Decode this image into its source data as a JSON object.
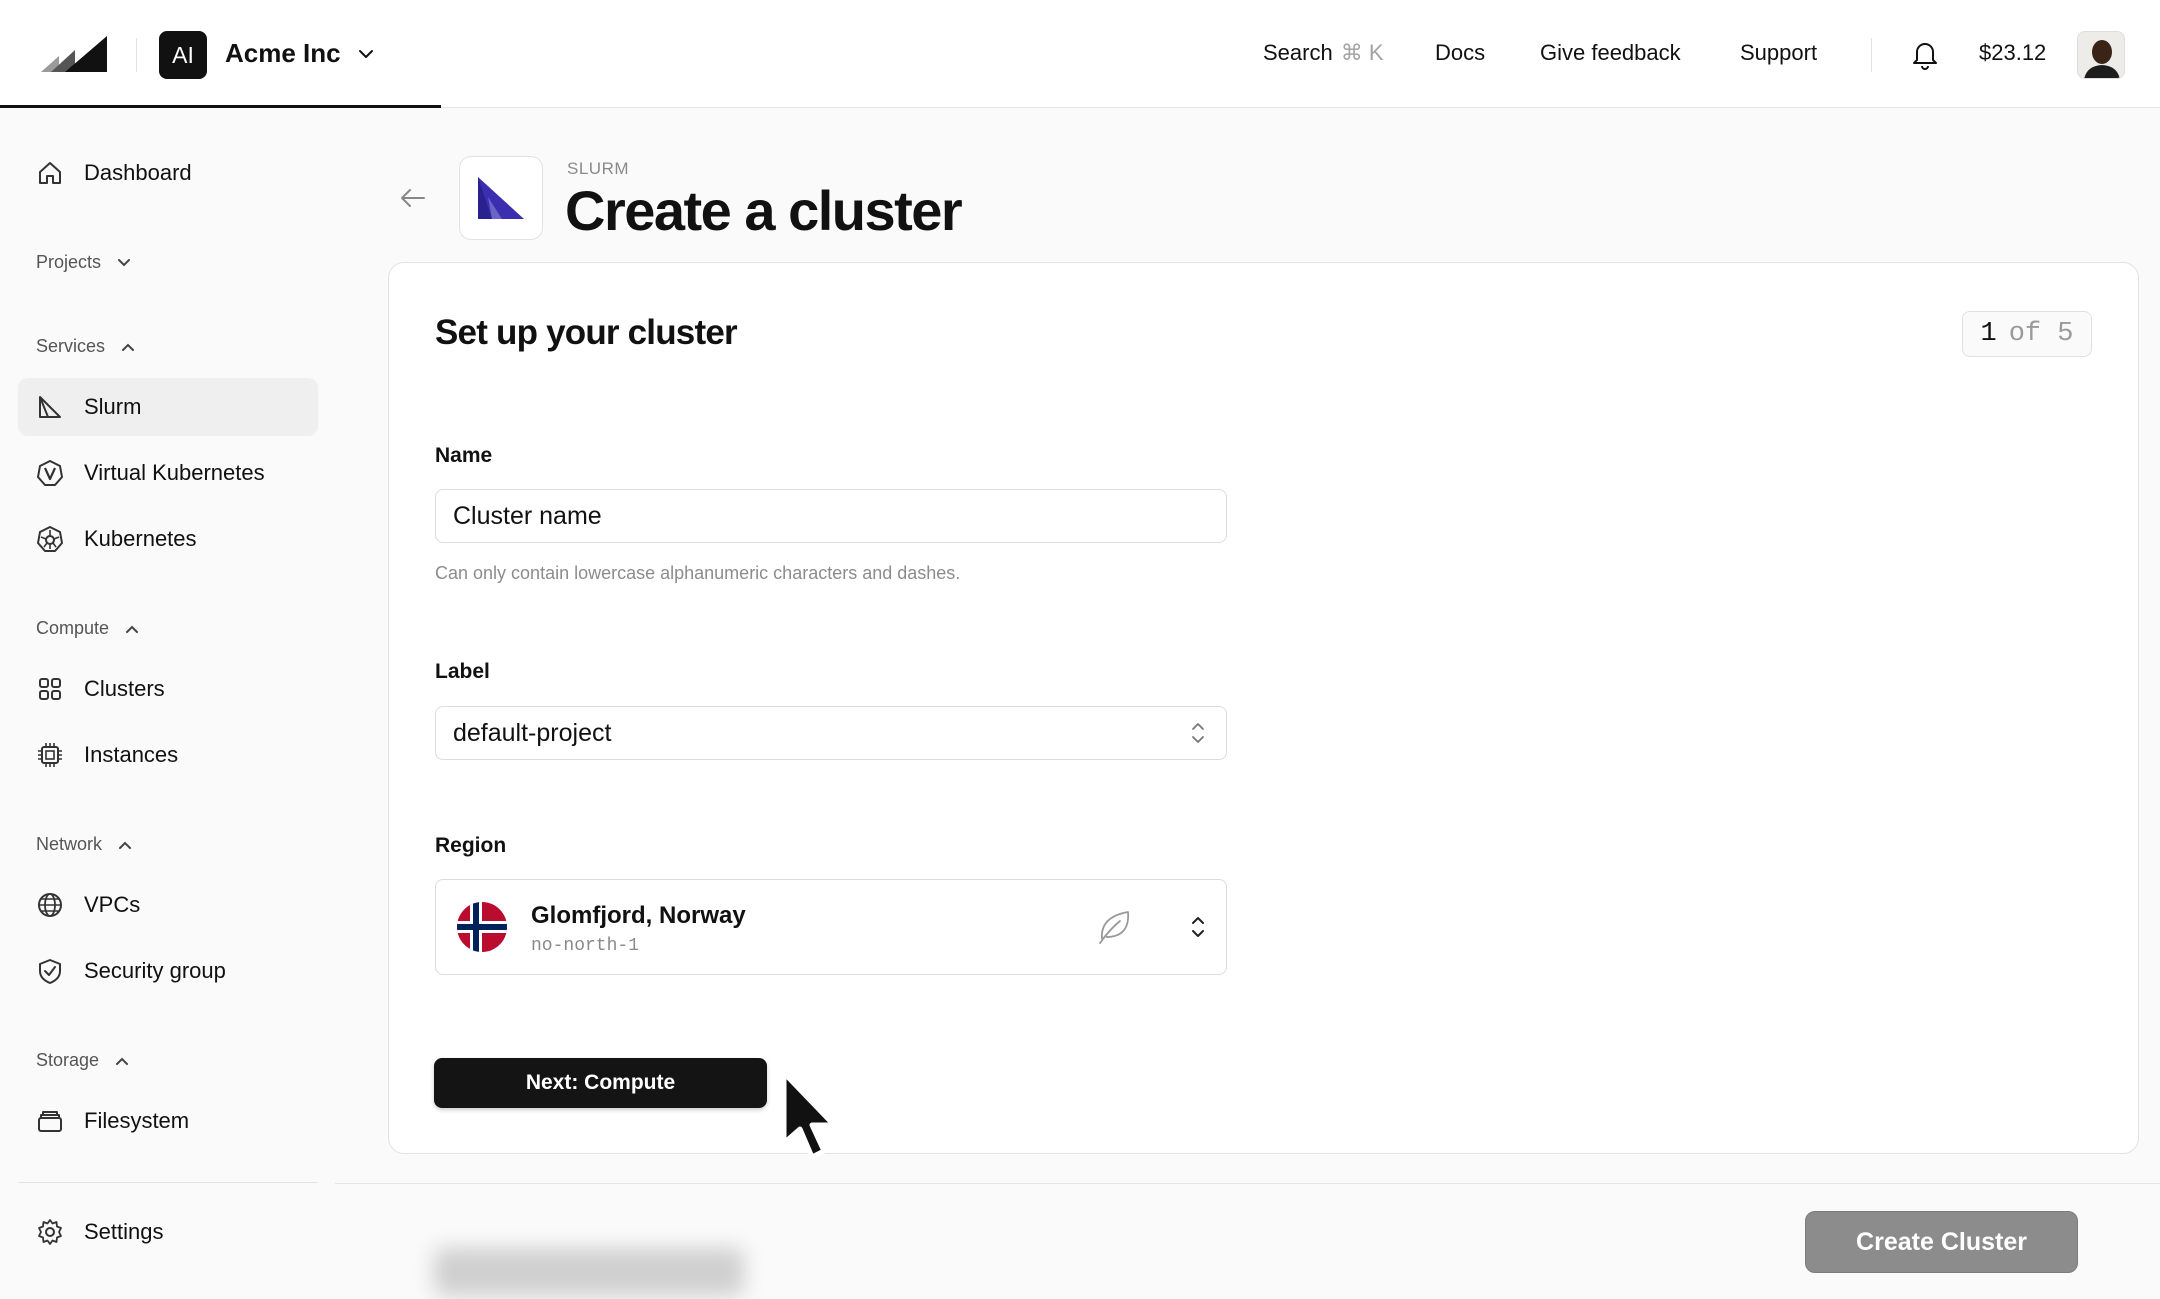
{
  "topbar": {
    "org_initials": "AI",
    "org_name": "Acme Inc",
    "search_label": "Search",
    "search_shortcut": "⌘ K",
    "docs": "Docs",
    "feedback": "Give feedback",
    "support": "Support",
    "balance": "$23.12"
  },
  "sidebar": {
    "dashboard": "Dashboard",
    "projects": "Projects",
    "services": "Services",
    "slurm": "Slurm",
    "virtual_kubernetes": "Virtual Kubernetes",
    "kubernetes": "Kubernetes",
    "compute": "Compute",
    "clusters": "Clusters",
    "instances": "Instances",
    "network": "Network",
    "vpcs": "VPCs",
    "security_group": "Security group",
    "storage": "Storage",
    "filesystem": "Filesystem",
    "settings": "Settings"
  },
  "header": {
    "eyebrow": "SLURM",
    "title": "Create a cluster"
  },
  "card": {
    "title": "Set up your cluster",
    "step_current": "1",
    "step_rest": "of 5",
    "name_label": "Name",
    "name_value": "Cluster name",
    "name_hint": "Can only contain lowercase alphanumeric characters and dashes.",
    "label_label": "Label",
    "label_value": "default-project",
    "region_label": "Region",
    "region_name": "Glomfjord, Norway",
    "region_code": "no-north-1",
    "next_button": "Next: Compute"
  },
  "footer": {
    "create_button": "Create Cluster"
  },
  "colors": {
    "accent": "#141414",
    "slurm_brand": "#3b2fb0",
    "flag_red": "#ba0c2f",
    "flag_blue": "#00205b"
  }
}
